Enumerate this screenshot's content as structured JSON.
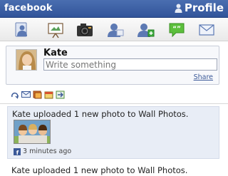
{
  "header": {
    "brand": "facebook",
    "profile_label": "Profile"
  },
  "toolbar": {
    "icons": [
      "friends-icon",
      "news-feed-icon",
      "camera-icon",
      "profile-icon",
      "add-friend-icon",
      "chat-icon",
      "inbox-icon"
    ]
  },
  "composer": {
    "user_name": "Kate",
    "placeholder": "Write something",
    "share_label": "Share"
  },
  "action_icons": [
    "refresh-icon",
    "messages-icon",
    "photos-icon",
    "events-icon",
    "pokes-icon"
  ],
  "feed": [
    {
      "text": "Kate uploaded 1 new photo to  Wall Photos.",
      "time": "3 minutes ago"
    },
    {
      "text": "Kate uploaded 1 new photo to  Wall Photos."
    }
  ],
  "colors": {
    "brand_blue": "#3b5998",
    "story_bg": "#e8edf6"
  }
}
